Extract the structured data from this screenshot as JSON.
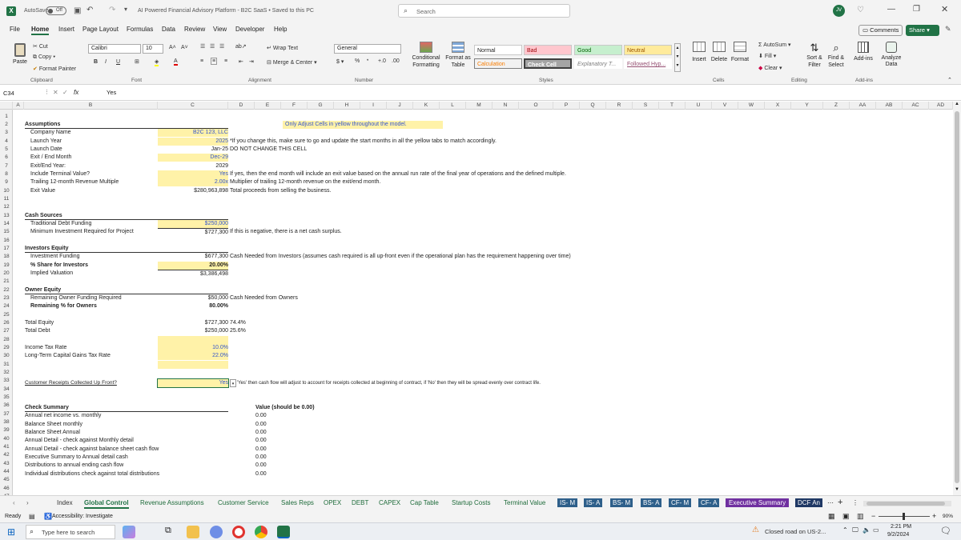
{
  "titlebar": {
    "autosave_label": "AutoSave",
    "autosave_state": "Off",
    "title": "AI Powered Financial Advisory Platform - B2C SaaS • Saved to this PC",
    "search_placeholder": "Search",
    "user_initials": "JV"
  },
  "menu": [
    "File",
    "Home",
    "Insert",
    "Page Layout",
    "Formulas",
    "Data",
    "Review",
    "View",
    "Developer",
    "Help"
  ],
  "menu_right": {
    "comments": "Comments",
    "share": "Share"
  },
  "ribbon": {
    "paste": "Paste",
    "cut": "Cut",
    "copy": "Copy",
    "format_painter": "Format Painter",
    "clipboard": "Clipboard",
    "font_name": "Calibri",
    "font_size": "10",
    "font": "Font",
    "wrap_text": "Wrap Text",
    "merge_center": "Merge & Center",
    "alignment": "Alignment",
    "number_format": "General",
    "number": "Number",
    "conditional": "Conditional Formatting",
    "format_as_table": "Format as Table",
    "styles": {
      "normal": "Normal",
      "bad": "Bad",
      "good": "Good",
      "neutral": "Neutral",
      "calculation": "Calculation",
      "check_cell": "Check Cell",
      "explanatory": "Explanatory T...",
      "followed": "Followed Hyp..."
    },
    "styles_label": "Styles",
    "insert": "Insert",
    "delete": "Delete",
    "format": "Format",
    "cells": "Cells",
    "autosum": "AutoSum",
    "fill": "Fill",
    "clear": "Clear",
    "sort_filter": "Sort & Filter",
    "find_select": "Find & Select",
    "editing": "Editing",
    "addins": "Add-ins",
    "analyze": "Analyze Data",
    "addins_group": "Add-ins"
  },
  "formula_bar": {
    "name_box": "C34",
    "fx": "fx",
    "value": "Yes"
  },
  "columns": [
    "A",
    "B",
    "C",
    "D",
    "E",
    "F",
    "G",
    "H",
    "I",
    "J",
    "K",
    "L",
    "M",
    "N",
    "O",
    "P",
    "Q",
    "R",
    "S",
    "T",
    "U",
    "V",
    "W",
    "X",
    "Y",
    "Z",
    "AA",
    "AB",
    "AC",
    "AD"
  ],
  "rows": [
    "1",
    "2",
    "3",
    "4",
    "5",
    "6",
    "7",
    "8",
    "9",
    "10",
    "11",
    "12",
    "13",
    "14",
    "15",
    "16",
    "17",
    "18",
    "19",
    "20",
    "21",
    "22",
    "23",
    "24",
    "25",
    "26",
    "27",
    "28",
    "29",
    "30",
    "31",
    "32",
    "33",
    "34",
    "35",
    "36",
    "37",
    "38",
    "39",
    "40",
    "41",
    "42",
    "43",
    "44",
    "45",
    "46",
    "47"
  ],
  "sheet": {
    "banner": "Only Adjust Cells in yellow throughout the model.",
    "assumptions": "Assumptions",
    "a_rows": [
      {
        "label": "Company Name",
        "value": "B2C 123, LLC",
        "note": ""
      },
      {
        "label": "Launch Year",
        "value": "2025",
        "note": "*If you change this, make sure to go and update the start months in all the yellow tabs to match accordingly."
      },
      {
        "label": "Launch Date",
        "value": "Jan-25",
        "note": "DO NOT CHANGE THIS CELL"
      },
      {
        "label": "Exit / End Month",
        "value": "Dec-29",
        "note": ""
      },
      {
        "label": "Exit/End Year:",
        "value": "2029",
        "note": ""
      },
      {
        "label": "Include Terminal Value?",
        "value": "Yes",
        "note": "If yes, then the end month will include an exit value based on the annual run rate of the final year of operations and the defined multiple."
      },
      {
        "label": "Trailing 12-month Revenue Multiple",
        "value": "2.00x",
        "note": "Multiplier of trailing 12-month revenue on the exit/end month."
      },
      {
        "label": "Exit Value",
        "value": "$280,963,898",
        "note": "Total proceeds from selling the business."
      }
    ],
    "cash_sources": "Cash Sources",
    "cs_rows": [
      {
        "label": "Traditional Debt Funding",
        "value": "$250,000",
        "note": ""
      },
      {
        "label": "Minimum Investment Required for Project",
        "value": "$727,300",
        "note": "If this is negative, there is a net cash surplus."
      }
    ],
    "investors_equity": "Investors Equity",
    "ie_rows": [
      {
        "label": "Investment Funding",
        "value": "$677,300",
        "note": "Cash Needed from Investors (assumes cash required is all up-front even if the operational plan has the requirement happening over time)"
      },
      {
        "label": "% Share for Investors",
        "value": "20.00%",
        "note": ""
      },
      {
        "label": "Implied Valuation",
        "value": "$3,386,498",
        "note": ""
      }
    ],
    "owner_equity": "Owner Equity",
    "oe_rows": [
      {
        "label": "Remaining Owner Funding Required",
        "value": "$50,000",
        "note": "Cash Needed from Owners"
      },
      {
        "label": "Remaining % for Owners",
        "value": "80.00%",
        "note": ""
      }
    ],
    "totals": [
      {
        "label": "Total Equity",
        "value": "$727,300",
        "note": "74.4%"
      },
      {
        "label": "Total Debt",
        "value": "$250,000",
        "note": "25.6%"
      }
    ],
    "tax": [
      {
        "label": "Income Tax Rate",
        "value": "10.0%"
      },
      {
        "label": "Long-Term Capital Gains Tax Rate",
        "value": "22.0%"
      }
    ],
    "receipts_label": "Customer Receipts Collected Up Front?",
    "receipts_value": "Yes",
    "receipts_note": "'Yes' then cash flow will adjust to account for receipts collected at beginning of contract, if 'No' then they will be spread evenly over contract life.",
    "check_summary": "Check Summary",
    "check_header": "Value (should be 0.00)",
    "checks": [
      {
        "label": "Annual net income vs. monthly",
        "value": "0.00"
      },
      {
        "label": "Balance Sheet monthly",
        "value": "0.00"
      },
      {
        "label": "Balance Sheet Annual",
        "value": "0.00"
      },
      {
        "label": "Annual Detail - check against Monthly detail",
        "value": "0.00"
      },
      {
        "label": "Annual Detail - check against balance sheet cash flow",
        "value": "0.00"
      },
      {
        "label": "Executive Summary to Annual detail cash",
        "value": "0.00"
      },
      {
        "label": "Distributions to annual ending cash flow",
        "value": "0.00"
      },
      {
        "label": "Individual distributions check against total distributions",
        "value": "0.00"
      }
    ]
  },
  "tabs": [
    "Index",
    "Global Control",
    "Revenue Assumptions",
    "Customer Service",
    "Sales Reps",
    "OPEX",
    "DEBT",
    "CAPEX",
    "Cap Table",
    "Startup Costs",
    "Terminal Value",
    "IS- M",
    "IS- A",
    "BS- M",
    "BS- A",
    "CF- M",
    "CF- A",
    "Executive Summary",
    "DCF An"
  ],
  "status": {
    "ready": "Ready",
    "accessibility": "Accessibility: Investigate",
    "zoom": "90%"
  },
  "taskbar": {
    "search": "Type here to search",
    "weather": "Closed road on US-2...",
    "time": "2:21 PM",
    "date": "9/2/2024"
  },
  "colors": {
    "excel_green": "#217346",
    "yellow_cell": "#fff2a8",
    "bad_bg": "#ffc7ce",
    "good_bg": "#c6efce",
    "neutral_bg": "#ffeb9c",
    "check_cell_bg": "#a5a5a5",
    "exec_tab": "#7030a0"
  }
}
